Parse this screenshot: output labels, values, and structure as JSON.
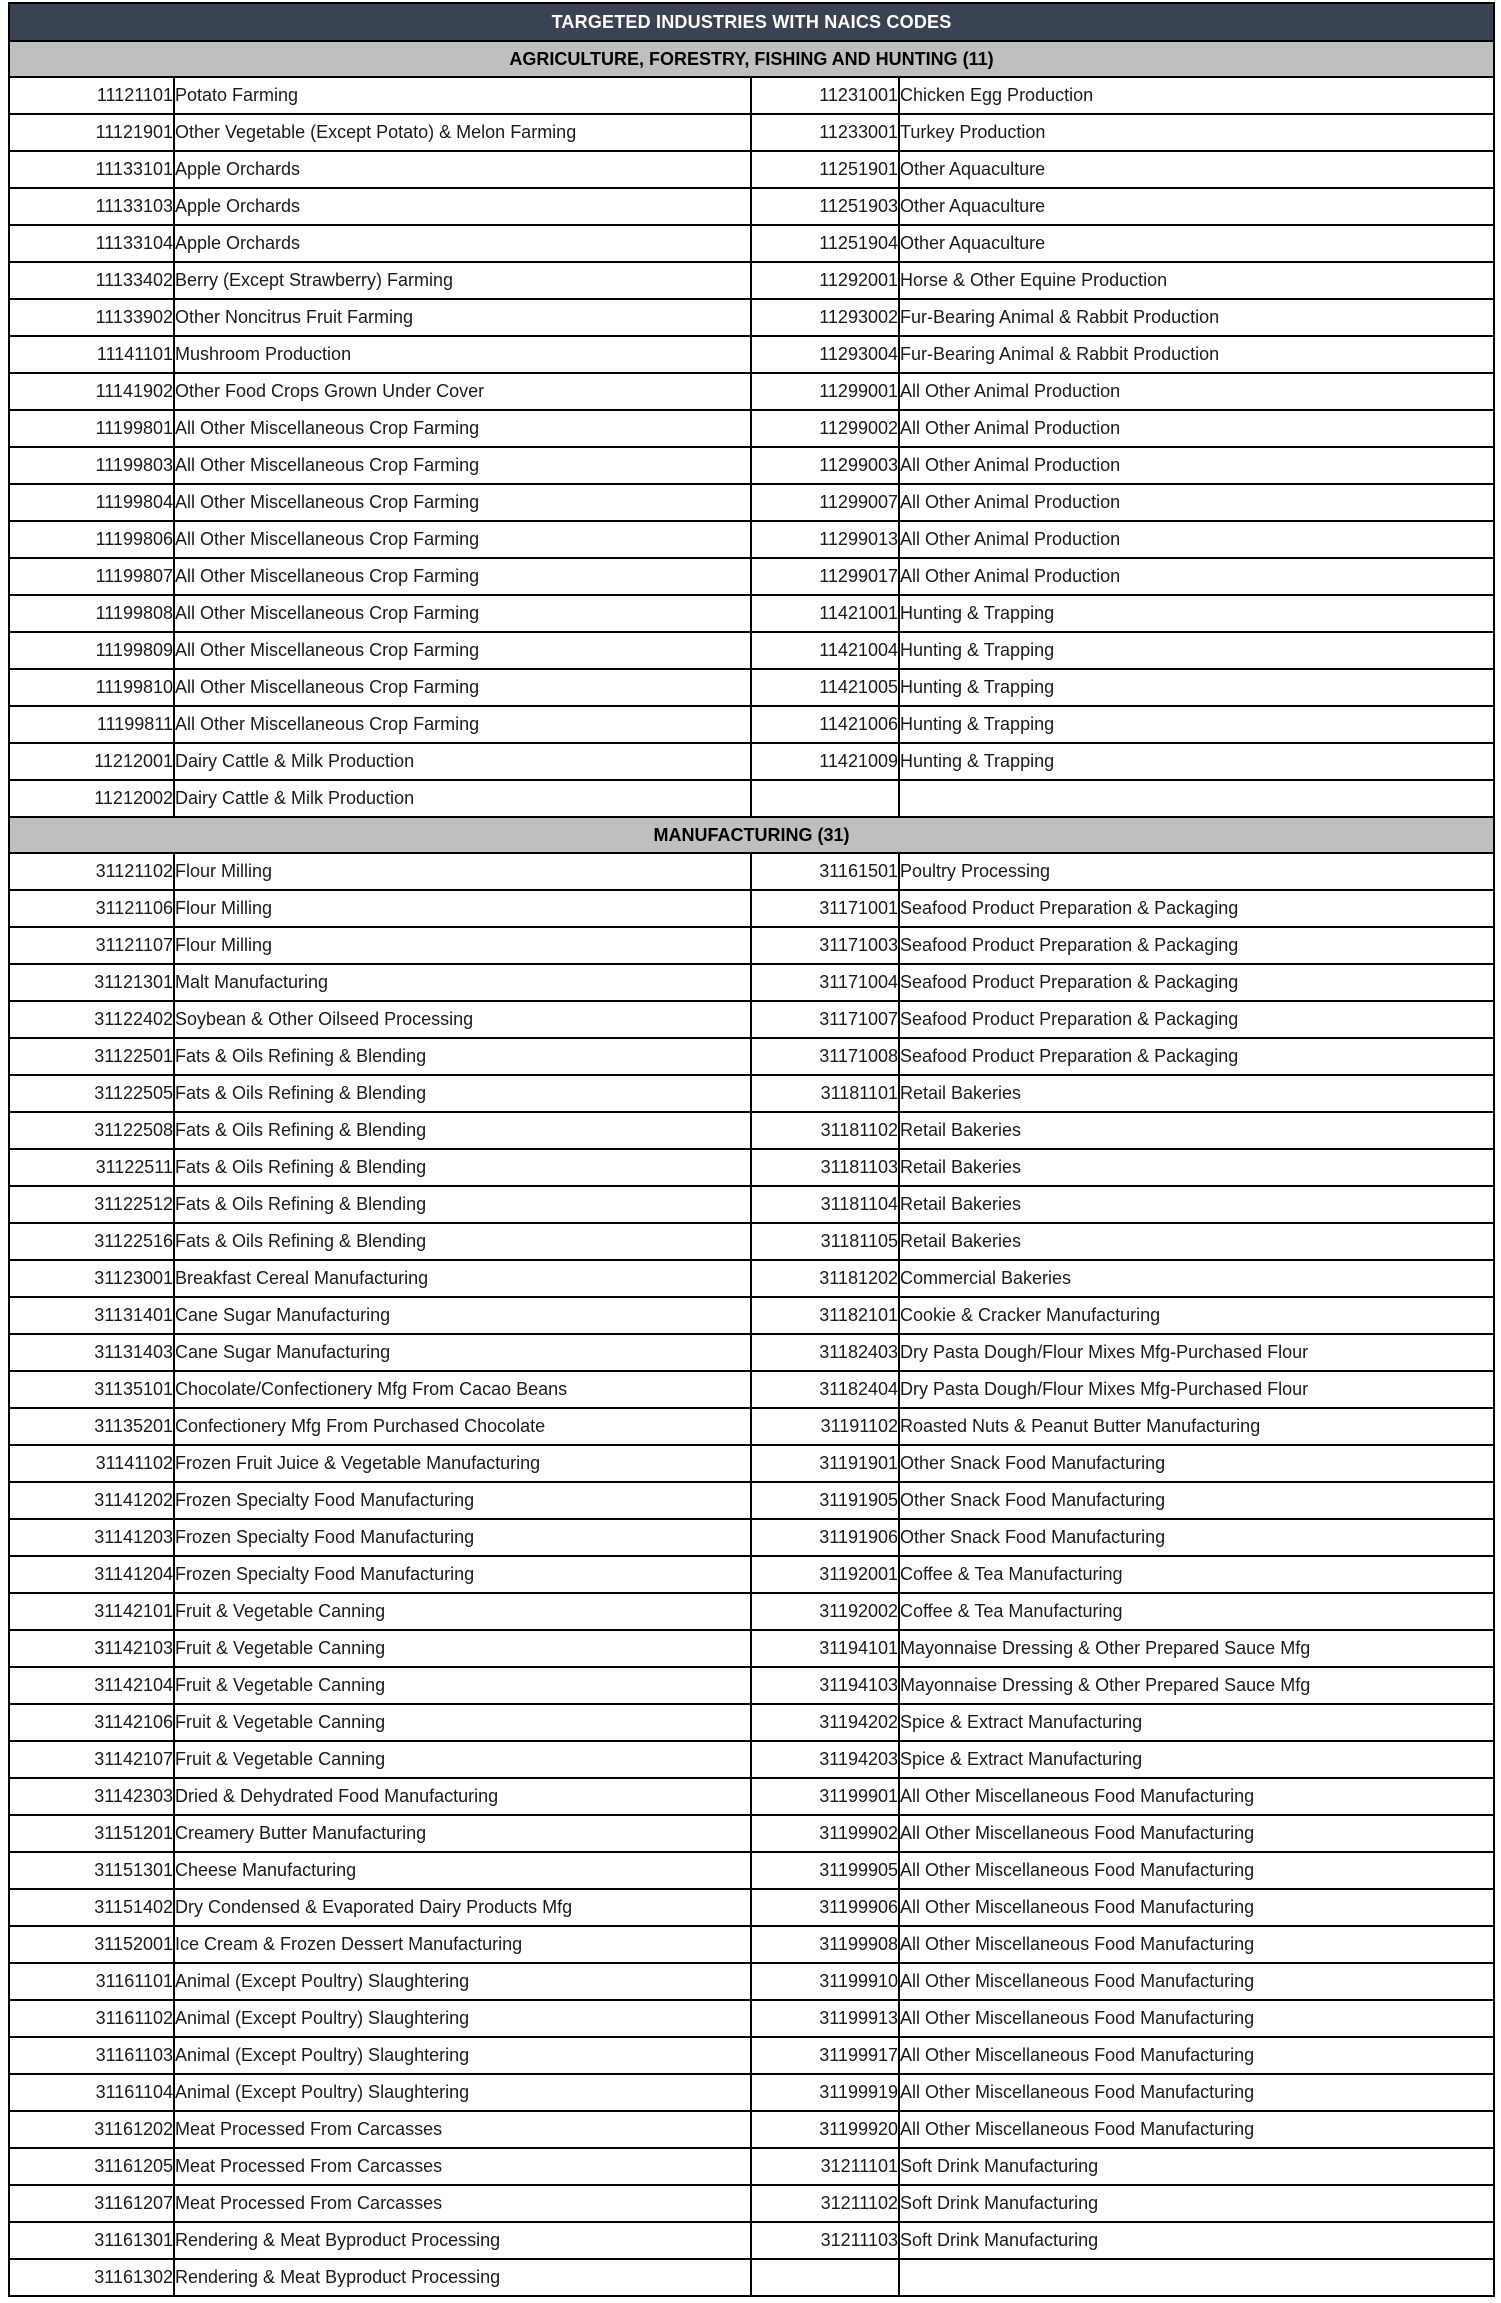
{
  "title": "TARGETED INDUSTRIES WITH NAICS CODES",
  "colors": {
    "title_bar_bg": "#3a4354",
    "title_bar_text": "#ffffff",
    "section_bar_bg": "#bfbfbf",
    "border": "#000000",
    "cell_bg": "#ffffff",
    "cell_text": "#1a1a1a"
  },
  "sections": [
    {
      "heading": "AGRICULTURE, FORESTRY, FISHING AND HUNTING (11)",
      "rows": [
        {
          "left_code": "11121101",
          "left_desc": "Potato Farming",
          "right_code": "11231001",
          "right_desc": "Chicken Egg Production"
        },
        {
          "left_code": "11121901",
          "left_desc": "Other Vegetable (Except Potato) & Melon Farming",
          "right_code": "11233001",
          "right_desc": "Turkey Production"
        },
        {
          "left_code": "11133101",
          "left_desc": "Apple Orchards",
          "right_code": "11251901",
          "right_desc": "Other Aquaculture"
        },
        {
          "left_code": "11133103",
          "left_desc": "Apple Orchards",
          "right_code": "11251903",
          "right_desc": "Other Aquaculture"
        },
        {
          "left_code": "11133104",
          "left_desc": "Apple Orchards",
          "right_code": "11251904",
          "right_desc": "Other Aquaculture"
        },
        {
          "left_code": "11133402",
          "left_desc": "Berry (Except Strawberry) Farming",
          "right_code": "11292001",
          "right_desc": "Horse & Other Equine Production"
        },
        {
          "left_code": "11133902",
          "left_desc": "Other Noncitrus Fruit Farming",
          "right_code": "11293002",
          "right_desc": "Fur-Bearing Animal & Rabbit Production"
        },
        {
          "left_code": "11141101",
          "left_desc": "Mushroom Production",
          "right_code": "11293004",
          "right_desc": "Fur-Bearing Animal & Rabbit Production"
        },
        {
          "left_code": "11141902",
          "left_desc": "Other Food Crops Grown Under Cover",
          "right_code": "11299001",
          "right_desc": "All Other Animal Production"
        },
        {
          "left_code": "11199801",
          "left_desc": "All Other Miscellaneous Crop Farming",
          "right_code": "11299002",
          "right_desc": "All Other Animal Production"
        },
        {
          "left_code": "11199803",
          "left_desc": "All Other Miscellaneous Crop Farming",
          "right_code": "11299003",
          "right_desc": "All Other Animal Production"
        },
        {
          "left_code": "11199804",
          "left_desc": "All Other Miscellaneous Crop Farming",
          "right_code": "11299007",
          "right_desc": "All Other Animal Production"
        },
        {
          "left_code": "11199806",
          "left_desc": "All Other Miscellaneous Crop Farming",
          "right_code": "11299013",
          "right_desc": "All Other Animal Production"
        },
        {
          "left_code": "11199807",
          "left_desc": "All Other Miscellaneous Crop Farming",
          "right_code": "11299017",
          "right_desc": "All Other Animal Production"
        },
        {
          "left_code": "11199808",
          "left_desc": "All Other Miscellaneous Crop Farming",
          "right_code": "11421001",
          "right_desc": "Hunting & Trapping"
        },
        {
          "left_code": "11199809",
          "left_desc": "All Other Miscellaneous Crop Farming",
          "right_code": "11421004",
          "right_desc": "Hunting & Trapping"
        },
        {
          "left_code": "11199810",
          "left_desc": "All Other Miscellaneous Crop Farming",
          "right_code": "11421005",
          "right_desc": "Hunting & Trapping"
        },
        {
          "left_code": "11199811",
          "left_desc": "All Other Miscellaneous Crop Farming",
          "right_code": "11421006",
          "right_desc": "Hunting & Trapping"
        },
        {
          "left_code": "11212001",
          "left_desc": "Dairy Cattle & Milk Production",
          "right_code": "11421009",
          "right_desc": "Hunting & Trapping"
        },
        {
          "left_code": "11212002",
          "left_desc": "Dairy Cattle & Milk Production",
          "right_code": "",
          "right_desc": ""
        }
      ]
    },
    {
      "heading": "MANUFACTURING (31)",
      "rows": [
        {
          "left_code": "31121102",
          "left_desc": "Flour Milling",
          "right_code": "31161501",
          "right_desc": "Poultry Processing"
        },
        {
          "left_code": "31121106",
          "left_desc": "Flour Milling",
          "right_code": "31171001",
          "right_desc": "Seafood Product Preparation & Packaging"
        },
        {
          "left_code": "31121107",
          "left_desc": "Flour Milling",
          "right_code": "31171003",
          "right_desc": "Seafood Product Preparation & Packaging"
        },
        {
          "left_code": "31121301",
          "left_desc": "Malt Manufacturing",
          "right_code": "31171004",
          "right_desc": "Seafood Product Preparation & Packaging"
        },
        {
          "left_code": "31122402",
          "left_desc": "Soybean & Other Oilseed Processing",
          "right_code": "31171007",
          "right_desc": "Seafood Product Preparation & Packaging"
        },
        {
          "left_code": "31122501",
          "left_desc": "Fats & Oils Refining & Blending",
          "right_code": "31171008",
          "right_desc": "Seafood Product Preparation & Packaging"
        },
        {
          "left_code": "31122505",
          "left_desc": "Fats & Oils Refining & Blending",
          "right_code": "31181101",
          "right_desc": "Retail Bakeries"
        },
        {
          "left_code": "31122508",
          "left_desc": "Fats & Oils Refining & Blending",
          "right_code": "31181102",
          "right_desc": "Retail Bakeries"
        },
        {
          "left_code": "31122511",
          "left_desc": "Fats & Oils Refining & Blending",
          "right_code": "31181103",
          "right_desc": "Retail Bakeries"
        },
        {
          "left_code": "31122512",
          "left_desc": "Fats & Oils Refining & Blending",
          "right_code": "31181104",
          "right_desc": "Retail Bakeries"
        },
        {
          "left_code": "31122516",
          "left_desc": "Fats & Oils Refining & Blending",
          "right_code": "31181105",
          "right_desc": "Retail Bakeries"
        },
        {
          "left_code": "31123001",
          "left_desc": "Breakfast Cereal Manufacturing",
          "right_code": "31181202",
          "right_desc": "Commercial Bakeries"
        },
        {
          "left_code": "31131401",
          "left_desc": "Cane Sugar Manufacturing",
          "right_code": "31182101",
          "right_desc": "Cookie & Cracker Manufacturing"
        },
        {
          "left_code": "31131403",
          "left_desc": "Cane Sugar Manufacturing",
          "right_code": "31182403",
          "right_desc": "Dry Pasta Dough/Flour Mixes Mfg-Purchased Flour"
        },
        {
          "left_code": "31135101",
          "left_desc": "Chocolate/Confectionery Mfg From Cacao Beans",
          "right_code": "31182404",
          "right_desc": "Dry Pasta Dough/Flour Mixes Mfg-Purchased Flour"
        },
        {
          "left_code": "31135201",
          "left_desc": "Confectionery Mfg From Purchased Chocolate",
          "right_code": "31191102",
          "right_desc": "Roasted Nuts & Peanut Butter Manufacturing"
        },
        {
          "left_code": "31141102",
          "left_desc": "Frozen Fruit Juice & Vegetable Manufacturing",
          "right_code": "31191901",
          "right_desc": "Other Snack Food Manufacturing"
        },
        {
          "left_code": "31141202",
          "left_desc": "Frozen Specialty Food Manufacturing",
          "right_code": "31191905",
          "right_desc": "Other Snack Food Manufacturing"
        },
        {
          "left_code": "31141203",
          "left_desc": "Frozen Specialty Food Manufacturing",
          "right_code": "31191906",
          "right_desc": "Other Snack Food Manufacturing"
        },
        {
          "left_code": "31141204",
          "left_desc": "Frozen Specialty Food Manufacturing",
          "right_code": "31192001",
          "right_desc": "Coffee & Tea Manufacturing"
        },
        {
          "left_code": "31142101",
          "left_desc": "Fruit & Vegetable Canning",
          "right_code": "31192002",
          "right_desc": "Coffee & Tea Manufacturing"
        },
        {
          "left_code": "31142103",
          "left_desc": "Fruit & Vegetable Canning",
          "right_code": "31194101",
          "right_desc": "Mayonnaise Dressing & Other Prepared Sauce Mfg"
        },
        {
          "left_code": "31142104",
          "left_desc": "Fruit & Vegetable Canning",
          "right_code": "31194103",
          "right_desc": "Mayonnaise Dressing & Other Prepared Sauce Mfg"
        },
        {
          "left_code": "31142106",
          "left_desc": "Fruit & Vegetable Canning",
          "right_code": "31194202",
          "right_desc": "Spice & Extract Manufacturing"
        },
        {
          "left_code": "31142107",
          "left_desc": "Fruit & Vegetable Canning",
          "right_code": "31194203",
          "right_desc": "Spice & Extract Manufacturing"
        },
        {
          "left_code": "31142303",
          "left_desc": "Dried & Dehydrated Food Manufacturing",
          "right_code": "31199901",
          "right_desc": "All Other Miscellaneous Food Manufacturing"
        },
        {
          "left_code": "31151201",
          "left_desc": "Creamery Butter Manufacturing",
          "right_code": "31199902",
          "right_desc": "All Other Miscellaneous Food Manufacturing"
        },
        {
          "left_code": "31151301",
          "left_desc": "Cheese Manufacturing",
          "right_code": "31199905",
          "right_desc": "All Other Miscellaneous Food Manufacturing"
        },
        {
          "left_code": "31151402",
          "left_desc": "Dry Condensed & Evaporated Dairy Products Mfg",
          "right_code": "31199906",
          "right_desc": "All Other Miscellaneous Food Manufacturing"
        },
        {
          "left_code": "31152001",
          "left_desc": "Ice Cream & Frozen Dessert Manufacturing",
          "right_code": "31199908",
          "right_desc": "All Other Miscellaneous Food Manufacturing"
        },
        {
          "left_code": "31161101",
          "left_desc": "Animal (Except Poultry) Slaughtering",
          "right_code": "31199910",
          "right_desc": "All Other Miscellaneous Food Manufacturing"
        },
        {
          "left_code": "31161102",
          "left_desc": "Animal (Except Poultry) Slaughtering",
          "right_code": "31199913",
          "right_desc": "All Other Miscellaneous Food Manufacturing"
        },
        {
          "left_code": "31161103",
          "left_desc": "Animal (Except Poultry) Slaughtering",
          "right_code": "31199917",
          "right_desc": "All Other Miscellaneous Food Manufacturing"
        },
        {
          "left_code": "31161104",
          "left_desc": "Animal (Except Poultry) Slaughtering",
          "right_code": "31199919",
          "right_desc": "All Other Miscellaneous Food Manufacturing"
        },
        {
          "left_code": "31161202",
          "left_desc": "Meat Processed From Carcasses",
          "right_code": "31199920",
          "right_desc": "All Other Miscellaneous Food Manufacturing"
        },
        {
          "left_code": "31161205",
          "left_desc": "Meat Processed From Carcasses",
          "right_code": "31211101",
          "right_desc": "Soft Drink Manufacturing"
        },
        {
          "left_code": "31161207",
          "left_desc": "Meat Processed From Carcasses",
          "right_code": "31211102",
          "right_desc": "Soft Drink Manufacturing"
        },
        {
          "left_code": "31161301",
          "left_desc": "Rendering & Meat Byproduct Processing",
          "right_code": "31211103",
          "right_desc": "Soft Drink Manufacturing"
        },
        {
          "left_code": "31161302",
          "left_desc": "Rendering & Meat Byproduct Processing",
          "right_code": "",
          "right_desc": ""
        }
      ]
    }
  ]
}
